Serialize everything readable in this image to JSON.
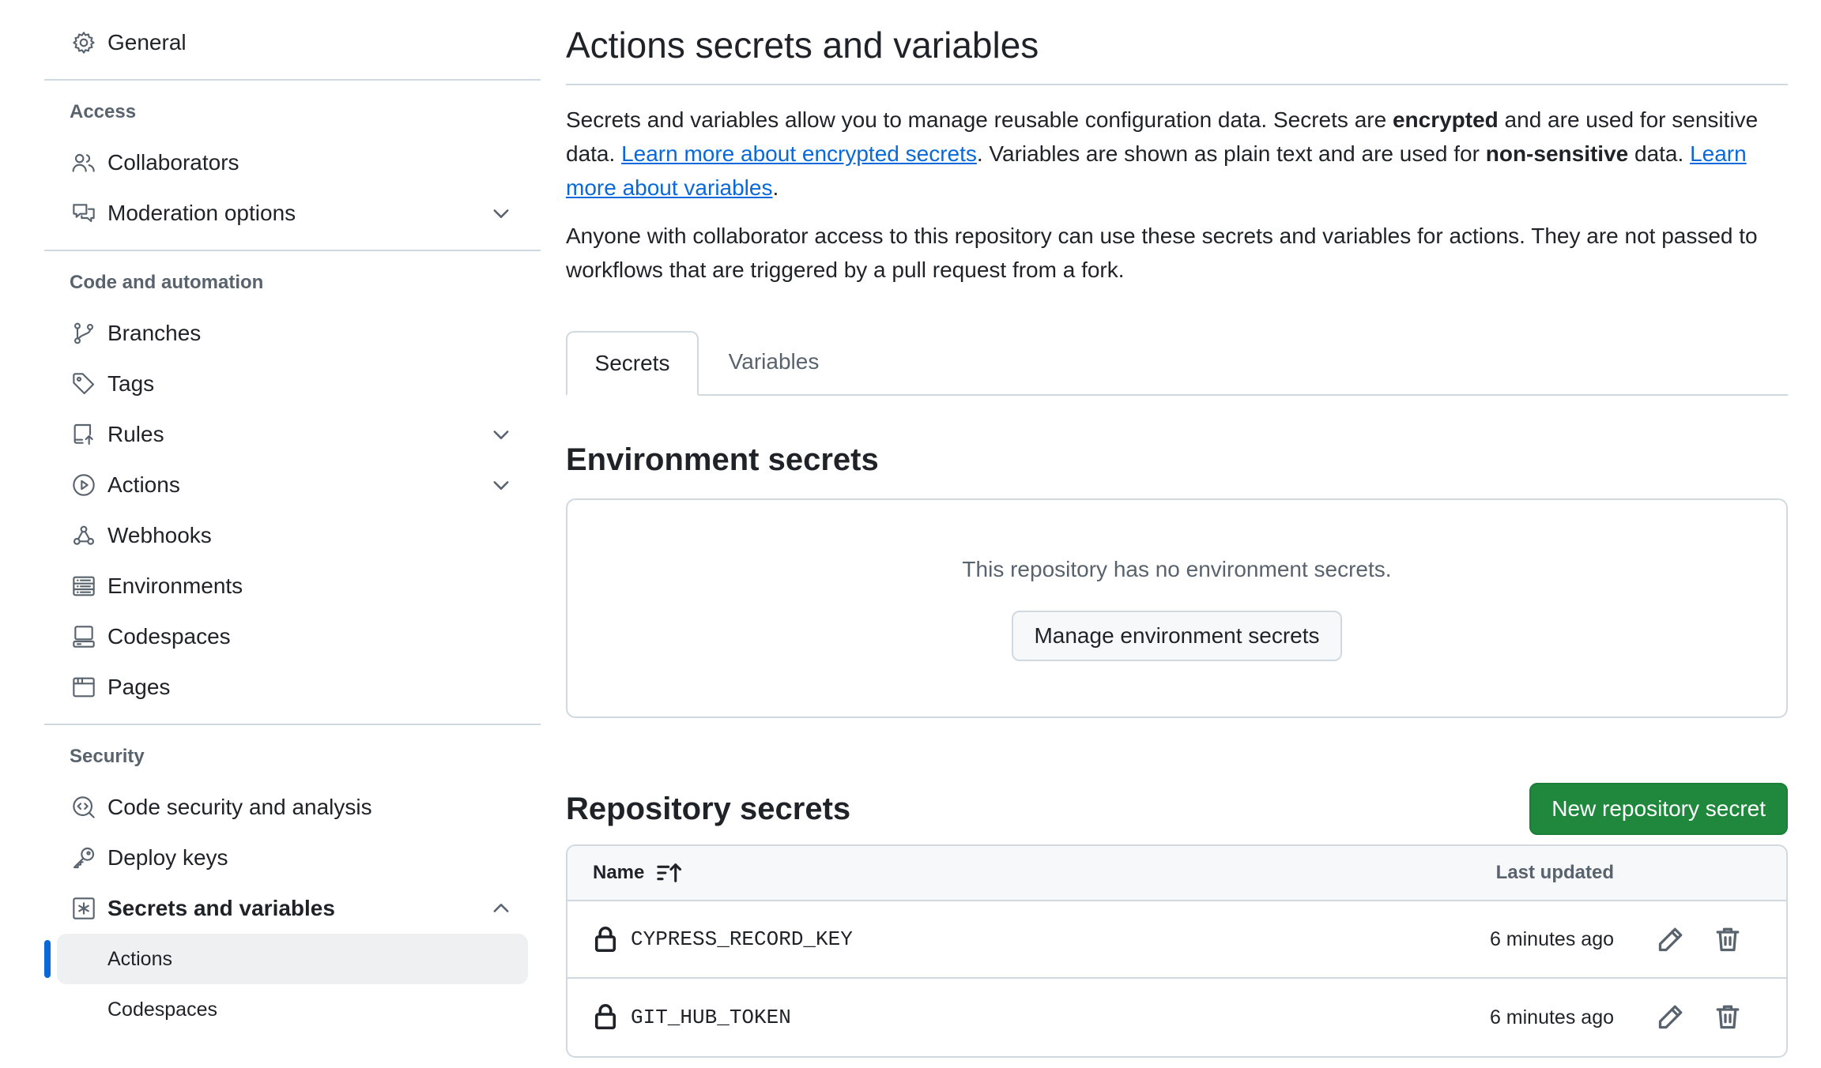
{
  "sidebar": {
    "general": "General",
    "sections": {
      "access": "Access",
      "code": "Code and automation",
      "security": "Security"
    },
    "items": {
      "collaborators": "Collaborators",
      "moderation": "Moderation options",
      "branches": "Branches",
      "tags": "Tags",
      "rules": "Rules",
      "actions": "Actions",
      "webhooks": "Webhooks",
      "environments": "Environments",
      "codespaces": "Codespaces",
      "pages": "Pages",
      "code_security": "Code security and analysis",
      "deploy_keys": "Deploy keys",
      "secrets": "Secrets and variables"
    },
    "sub_items": {
      "actions": "Actions",
      "codespaces": "Codespaces"
    }
  },
  "main": {
    "title": "Actions secrets and variables",
    "intro": {
      "p1_a": "Secrets and variables allow you to manage reusable configuration data. Secrets are ",
      "p1_b": "encrypted",
      "p1_c": " and are used for sensitive data. ",
      "p1_link1": "Learn more about encrypted secrets",
      "p1_d": ". Variables are shown as plain text and are used for ",
      "p1_e": "non-sensitive",
      "p1_f": " data. ",
      "p1_link2": "Learn more about variables",
      "p1_g": ".",
      "p2": "Anyone with collaborator access to this repository can use these secrets and variables for actions. They are not passed to workflows that are triggered by a pull request from a fork."
    },
    "tabs": {
      "secrets": "Secrets",
      "variables": "Variables"
    },
    "environment": {
      "title": "Environment secrets",
      "empty": "This repository has no environment secrets.",
      "manage_button": "Manage environment secrets"
    },
    "repository": {
      "title": "Repository secrets",
      "new_button": "New repository secret",
      "columns": {
        "name": "Name",
        "updated": "Last updated"
      },
      "rows": [
        {
          "name": "CYPRESS_RECORD_KEY",
          "updated": "6 minutes ago"
        },
        {
          "name": "GIT_HUB_TOKEN",
          "updated": "6 minutes ago"
        }
      ]
    }
  },
  "icons": {
    "general": "gear-icon",
    "collaborators": "people-icon",
    "moderation": "comment-discussion-icon",
    "branches": "git-branch-icon",
    "tags": "tag-icon",
    "rules": "repo-push-icon",
    "actions": "play-icon",
    "webhooks": "webhook-icon",
    "environments": "server-icon",
    "codespaces": "codespaces-icon",
    "pages": "browser-icon",
    "code_security": "codescan-icon",
    "deploy_keys": "key-icon",
    "secrets": "key-asterisk-icon"
  },
  "colors": {
    "accent": "#0969da",
    "primary_button": "#1f883d",
    "border": "#d1d9e0",
    "muted_text": "#59636e"
  }
}
